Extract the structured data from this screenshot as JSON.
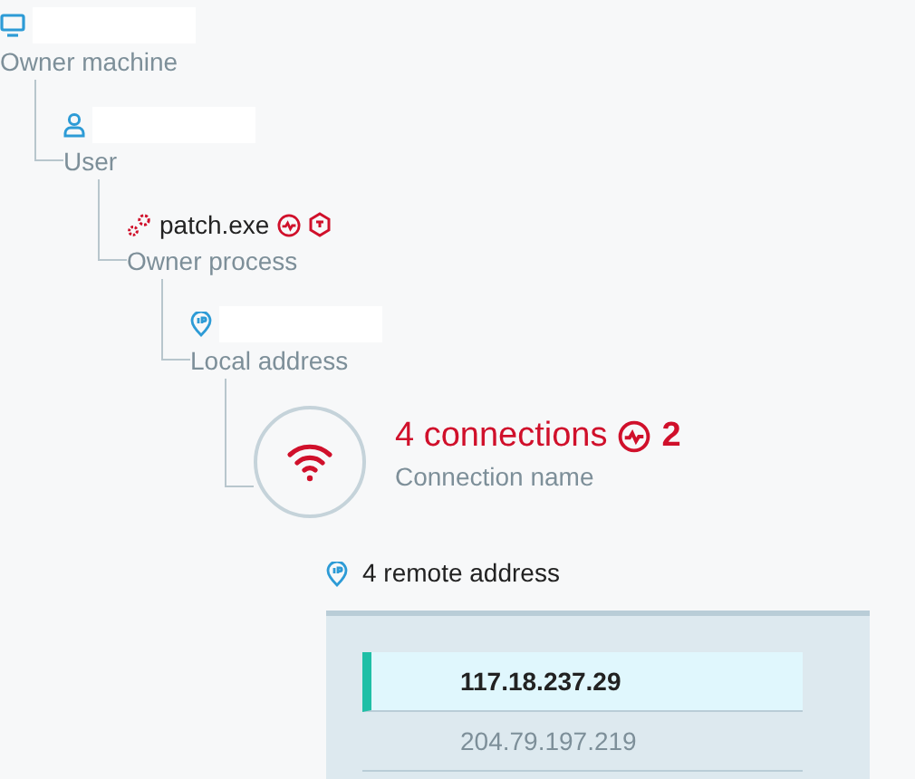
{
  "tree": {
    "kind": "machine",
    "name_hidden": true,
    "label": "Owner machine",
    "children": [
      {
        "kind": "user",
        "name_hidden": true,
        "label": "User",
        "children": [
          {
            "kind": "process",
            "name": "patch.exe",
            "name_hidden": false,
            "label": "Owner process",
            "children": [
              {
                "kind": "address",
                "name_hidden": true,
                "label": "Local address",
                "children": [
                  {
                    "kind": "connection",
                    "name": "4 connections",
                    "count": "2",
                    "label": "Connection name"
                  }
                ]
              }
            ]
          }
        ]
      }
    ]
  },
  "remote": {
    "title": "4 remote address",
    "rows": [
      {
        "address": "117.18.237.29",
        "selected": true
      },
      {
        "address": "204.79.197.219",
        "selected": false
      }
    ]
  }
}
